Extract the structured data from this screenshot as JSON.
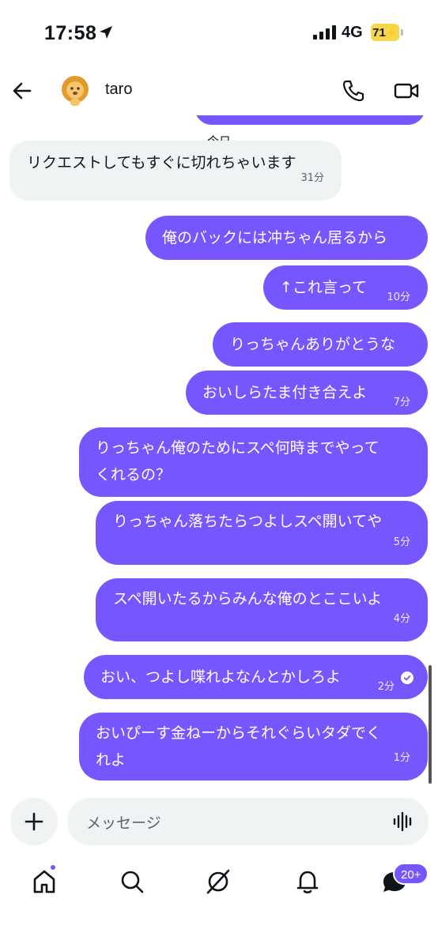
{
  "status_bar": {
    "time": "17:58",
    "network": "4G",
    "battery": "71"
  },
  "header": {
    "contact_name": "taro"
  },
  "chat": {
    "day_label": "今日",
    "messages": [
      {
        "dir": "in",
        "text": "リクエストしてもすぐに切れちゃいます",
        "time": "31分"
      },
      {
        "dir": "out",
        "text": "俺のバックには冲ちゃん居るから",
        "time": ""
      },
      {
        "dir": "out",
        "text": "↑これ言って",
        "time": "10分"
      },
      {
        "dir": "out",
        "text": "りっちゃんありがとうな",
        "time": ""
      },
      {
        "dir": "out",
        "text": "おいしらたま付き合えよ",
        "time": "7分"
      },
      {
        "dir": "out",
        "text": "りっちゃん俺のためにスペ何時までやって",
        "text2": "くれるの？",
        "time": ""
      },
      {
        "dir": "out",
        "text": "りっちゃん落ちたらつよしスペ開いてや",
        "time": "5分"
      },
      {
        "dir": "out",
        "text": "スペ開いたるからみんな俺のとここいよ",
        "time": "4分"
      },
      {
        "dir": "out",
        "text": "おい、つよし喋れよなんとかしろよ",
        "time": "2分"
      },
      {
        "dir": "out",
        "text": "おいぴーす金ねーからそれぐらいタダでく",
        "text2": "れよ",
        "time": "1分"
      }
    ]
  },
  "composer": {
    "placeholder": "メッセージ"
  },
  "nav": {
    "notifications_badge": "20+"
  },
  "colors": {
    "accent": "#7856ff",
    "incoming": "#eff3f4"
  }
}
